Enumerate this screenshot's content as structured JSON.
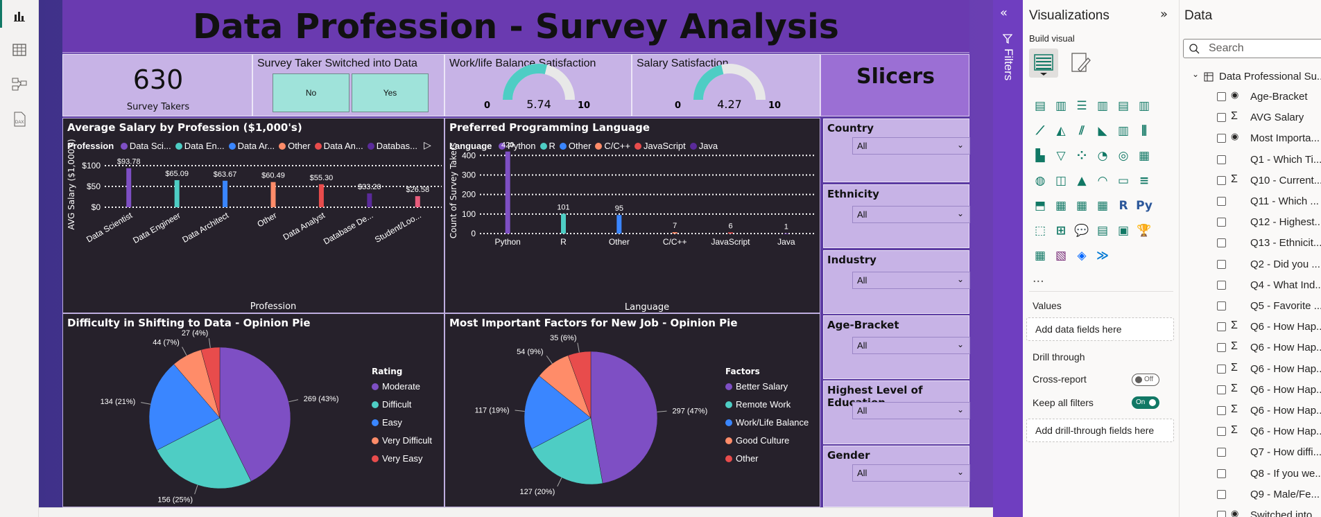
{
  "report": {
    "title": "Data Profession - Survey Analysis",
    "kpi": {
      "value": "630",
      "label": "Survey Takers"
    },
    "switched": {
      "title": "Survey Taker Switched into Data",
      "no": "No",
      "yes": "Yes"
    },
    "worklife": {
      "title": "Work/life Balance Satisfaction",
      "value": "5.74",
      "min": "0",
      "max": "10",
      "fraction": 0.574
    },
    "salarysat": {
      "title": "Salary Satisfaction",
      "value": "4.27",
      "min": "0",
      "max": "10",
      "fraction": 0.427
    },
    "slicers_title": "Slicers",
    "slicers": [
      {
        "label": "Country",
        "value": "All"
      },
      {
        "label": "Ethnicity",
        "value": "All"
      },
      {
        "label": "Industry",
        "value": "All"
      },
      {
        "label": "Age-Bracket",
        "value": "All"
      },
      {
        "label": "Highest Level of Education",
        "value": "All"
      },
      {
        "label": "Gender",
        "value": "All"
      }
    ],
    "colors": {
      "purple": "#7e4fc4",
      "teal": "#4ecdc4",
      "blue": "#3a86ff",
      "salmon": "#ff8c69",
      "red": "#e84c4c",
      "darkpurple": "#5a2a9a",
      "pink": "#e85c7c"
    }
  },
  "chart_data": [
    {
      "type": "bar",
      "title": "Average Salary by Profession ($1,000's)",
      "legend_title": "Profession",
      "legend_entries": [
        "Data Sci...",
        "Data En...",
        "Data Ar...",
        "Other",
        "Data An...",
        "Databas..."
      ],
      "categories": [
        "Data Scientist",
        "Data Engineer",
        "Data Architect",
        "Other",
        "Data Analyst",
        "Database De...",
        "Student/Loo..."
      ],
      "values": [
        93.78,
        65.09,
        63.67,
        60.49,
        55.3,
        33.2,
        26.58
      ],
      "data_labels": [
        "$93.78",
        "$65.09",
        "$63.67",
        "$60.49",
        "$55.30",
        "$33.20",
        "$26.58"
      ],
      "xlabel": "Profession",
      "ylabel": "AVG Salary ($1,000's)",
      "yticks": [
        "$100",
        "$50",
        "$0"
      ],
      "ylim": [
        0,
        110
      ]
    },
    {
      "type": "bar",
      "title": "Preferred Programming Language",
      "legend_title": "Language",
      "legend_entries": [
        "Python",
        "R",
        "Other",
        "C/C++",
        "JavaScript",
        "Java"
      ],
      "categories": [
        "Python",
        "R",
        "Other",
        "C/C++",
        "JavaScript",
        "Java"
      ],
      "values": [
        420,
        101,
        95,
        7,
        6,
        1
      ],
      "data_labels": [
        "420",
        "101",
        "95",
        "7",
        "6",
        "1"
      ],
      "xlabel": "Language",
      "ylabel": "Count of Survey Takers",
      "yticks": [
        "400",
        "300",
        "200",
        "100",
        "0"
      ],
      "ylim": [
        0,
        440
      ]
    },
    {
      "type": "pie",
      "title": "Difficulty in Shifting to Data - Opinion Pie",
      "legend_title": "Rating",
      "labels": [
        "Moderate",
        "Difficult",
        "Easy",
        "Very Difficult",
        "Very Easy"
      ],
      "values": [
        269,
        156,
        134,
        44,
        27
      ],
      "data_labels": [
        "269 (43%)",
        "156 (25%)",
        "134 (21%)",
        "44 (7%)",
        "27 (4%)"
      ]
    },
    {
      "type": "pie",
      "title": "Most Important Factors for New Job - Opinion Pie",
      "legend_title": "Factors",
      "labels": [
        "Better Salary",
        "Remote Work",
        "Work/Life Balance",
        "Good Culture",
        "Other"
      ],
      "values": [
        297,
        127,
        117,
        54,
        35
      ],
      "data_labels": [
        "297 (47%)",
        "127 (20%)",
        "117 (19%)",
        "54 (9%)",
        "35 (6%)"
      ]
    }
  ],
  "filters_label": "Filters",
  "visualizations": {
    "title": "Visualizations",
    "build_visual": "Build visual",
    "values_label": "Values",
    "values_placeholder": "Add data fields here",
    "drill_through": "Drill through",
    "cross_report": "Cross-report",
    "cross_report_state": "Off",
    "keep_filters": "Keep all filters",
    "keep_filters_state": "On",
    "drill_placeholder": "Add drill-through fields here",
    "more": "..."
  },
  "data_pane": {
    "title": "Data",
    "search_placeholder": "Search",
    "table_name": "Data Professional Su...",
    "fields": [
      {
        "icon": "hier",
        "name": "Age-Bracket"
      },
      {
        "icon": "sigma",
        "name": "AVG Salary"
      },
      {
        "icon": "hier",
        "name": "Most Importa..."
      },
      {
        "icon": "",
        "name": "Q1 - Which Ti..."
      },
      {
        "icon": "sigma",
        "name": "Q10 - Current..."
      },
      {
        "icon": "",
        "name": "Q11 - Which ..."
      },
      {
        "icon": "",
        "name": "Q12 - Highest..."
      },
      {
        "icon": "",
        "name": "Q13 - Ethnicit..."
      },
      {
        "icon": "",
        "name": "Q2 - Did you ..."
      },
      {
        "icon": "",
        "name": "Q4 - What Ind..."
      },
      {
        "icon": "",
        "name": "Q5 - Favorite ..."
      },
      {
        "icon": "sigma",
        "name": "Q6 - How Hap..."
      },
      {
        "icon": "sigma",
        "name": "Q6 - How Hap..."
      },
      {
        "icon": "sigma",
        "name": "Q6 - How Hap..."
      },
      {
        "icon": "sigma",
        "name": "Q6 - How Hap..."
      },
      {
        "icon": "sigma",
        "name": "Q6 - How Hap..."
      },
      {
        "icon": "sigma",
        "name": "Q6 - How Hap..."
      },
      {
        "icon": "",
        "name": "Q7 - How diffi..."
      },
      {
        "icon": "",
        "name": "Q8 - If you we..."
      },
      {
        "icon": "",
        "name": "Q9 - Male/Fe..."
      },
      {
        "icon": "hier",
        "name": "Switched into ..."
      }
    ]
  }
}
